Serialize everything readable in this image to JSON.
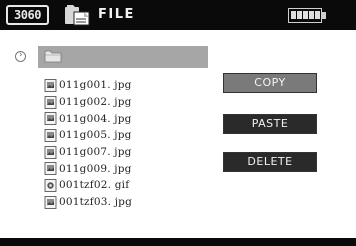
{
  "header": {
    "brand": "3060",
    "title": "FILE",
    "app_icon": "file-manager-icon",
    "battery_icon": "battery-full-icon"
  },
  "path_bar": {
    "back_icon": "back-circle-icon",
    "folder_icon": "folder-icon"
  },
  "files": [
    {
      "name": "011g001. jpg",
      "icon": "image-file-icon"
    },
    {
      "name": "011g002. jpg",
      "icon": "image-file-icon"
    },
    {
      "name": "011g004. jpg",
      "icon": "image-file-icon"
    },
    {
      "name": "011g005. jpg",
      "icon": "image-file-icon"
    },
    {
      "name": "011g007. jpg",
      "icon": "image-file-icon"
    },
    {
      "name": "011g009. jpg",
      "icon": "image-file-icon"
    },
    {
      "name": "001tzf02. gif",
      "icon": "gif-file-icon"
    },
    {
      "name": "001tzf03. jpg",
      "icon": "image-file-icon"
    }
  ],
  "actions": {
    "copy": "COPY",
    "paste": "PASTE",
    "delete": "DELETE"
  },
  "colors": {
    "titlebar": "#0a0a0a",
    "path_bar": "#a6a6a6",
    "copy_button": "#7a7a7a",
    "dark_button": "#2a2a2a"
  }
}
